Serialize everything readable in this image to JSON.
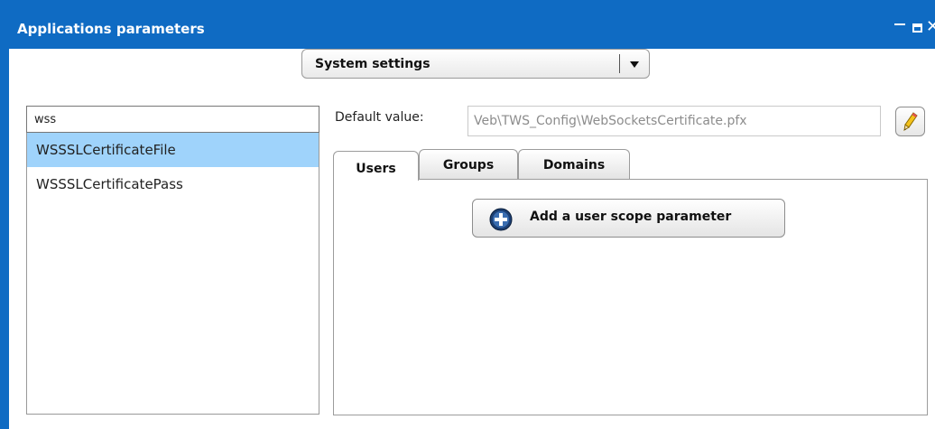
{
  "window": {
    "title": "Applications parameters",
    "colors": {
      "titlebar": "#0f6bc3",
      "selection": "#9fd3fb"
    }
  },
  "category_dropdown": {
    "selected": "System settings",
    "icon": "chevron-down-icon"
  },
  "search": {
    "value": "wss"
  },
  "parameters": {
    "items": [
      {
        "label": "WSSSLCertificateFile",
        "selected": true
      },
      {
        "label": "WSSSLCertificatePass",
        "selected": false
      }
    ]
  },
  "default_value": {
    "label": "Default value:",
    "value": "Veb\\TWS_Config\\WebSocketsCertificate.pfx",
    "edit_icon": "pencil-icon"
  },
  "tabs": [
    {
      "label": "Users",
      "active": true
    },
    {
      "label": "Groups",
      "active": false
    },
    {
      "label": "Domains",
      "active": false
    }
  ],
  "add_button": {
    "label": "Add a user scope parameter",
    "icon": "add-circle-icon"
  }
}
